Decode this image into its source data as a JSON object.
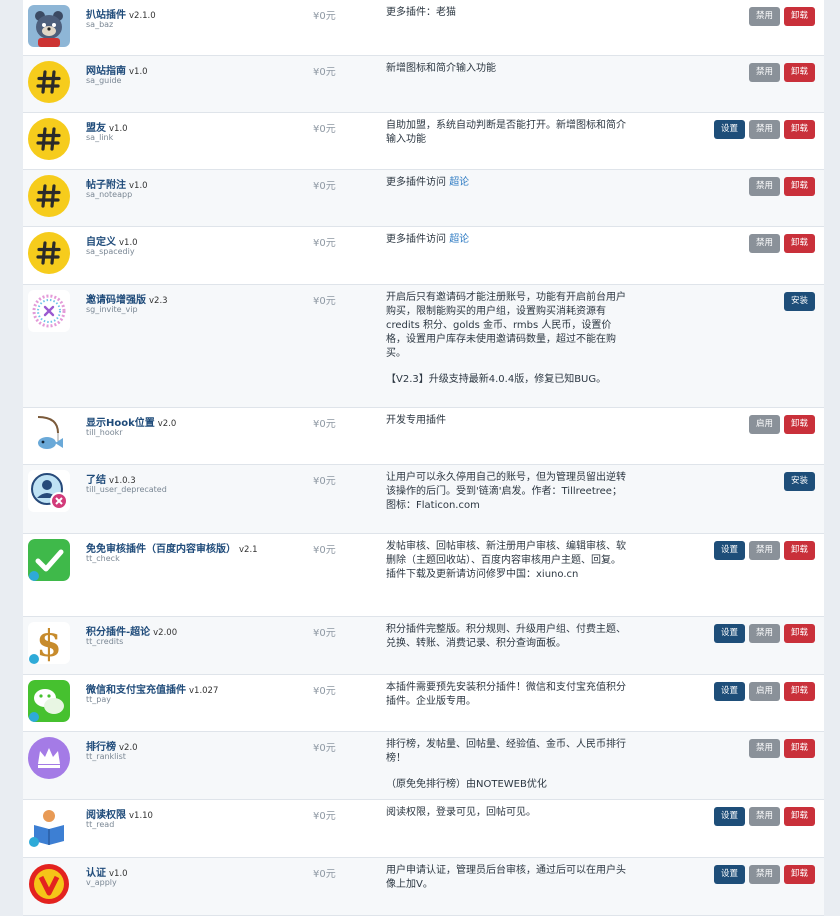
{
  "labels": {
    "settings": "设置",
    "disable": "禁用",
    "enable": "启用",
    "uninstall": "卸载",
    "install": "安装"
  },
  "plugins": [
    {
      "title": "扒站插件",
      "version": "v2.1.0",
      "id": "sa_baz",
      "price": "¥0元",
      "desc": [
        "更多插件：老猫"
      ],
      "link": "",
      "buttons": [
        "disable",
        "uninstall"
      ],
      "icon": "bear-icon"
    },
    {
      "title": "网站指南",
      "version": "v1.0",
      "id": "sa_guide",
      "price": "¥0元",
      "desc": [
        "新增图标和简介输入功能"
      ],
      "link": "",
      "buttons": [
        "disable",
        "uninstall"
      ],
      "icon": "hash-icon"
    },
    {
      "title": "盟友",
      "version": "v1.0",
      "id": "sa_link",
      "price": "¥0元",
      "desc": [
        "自助加盟，系统自动判断是否能打开。新增图标和简介输入功能"
      ],
      "link": "",
      "buttons": [
        "settings",
        "disable",
        "uninstall"
      ],
      "icon": "hash-icon"
    },
    {
      "title": "帖子附注",
      "version": "v1.0",
      "id": "sa_noteapp",
      "price": "¥0元",
      "desc": [
        "更多插件访问 "
      ],
      "link": "超论",
      "buttons": [
        "disable",
        "uninstall"
      ],
      "icon": "hash-icon"
    },
    {
      "title": "自定义",
      "version": "v1.0",
      "id": "sa_spacediy",
      "price": "¥0元",
      "desc": [
        "更多插件访问 "
      ],
      "link": "超论",
      "buttons": [
        "disable",
        "uninstall"
      ],
      "icon": "hash-icon"
    },
    {
      "title": "邀请码增强版",
      "version": "v2.3",
      "id": "sg_invite_vip",
      "price": "¥0元",
      "desc": [
        "开启后只有邀请码才能注册账号，功能有开启前台用户购买，限制能购买的用户组，设置购买消耗资源有 credits 积分、golds 金币、rmbs 人民币，设置价格，设置用户库存未使用邀请码数量，超过不能在购买。",
        "【V2.3】升级支持最新4.0.4版，修复已知BUG。"
      ],
      "link": "",
      "buttons": [
        "install"
      ],
      "icon": "invite-icon"
    },
    {
      "title": "显示Hook位置",
      "version": "v2.0",
      "id": "till_hookr",
      "price": "¥0元",
      "desc": [
        "开发专用插件"
      ],
      "link": "",
      "buttons": [
        "enable",
        "uninstall"
      ],
      "icon": "fishing-icon"
    },
    {
      "title": "了结",
      "version": "v1.0.3",
      "id": "till_user_deprecated",
      "price": "¥0元",
      "desc": [
        "让用户可以永久停用自己的账号，但为管理员留出逆转该操作的后门。受到'链滴'启发。作者：Tillreetree；图标：Flaticon.com"
      ],
      "link": "",
      "buttons": [
        "install"
      ],
      "icon": "user-remove-icon"
    },
    {
      "title": "免免审核插件（百度内容审核版）",
      "version": "v2.1",
      "id": "tt_check",
      "price": "¥0元",
      "desc": [
        "发帖审核、回帖审核、新注册用户审核、编辑审核、软删除（主题回收站）、百度内容审核用户主题、回复。插件下载及更新请访问修罗中国：xiuno.cn"
      ],
      "link": "",
      "buttons": [
        "settings",
        "disable",
        "uninstall"
      ],
      "icon": "check-icon"
    },
    {
      "title": "积分插件-超论",
      "version": "v2.00",
      "id": "tt_credits",
      "price": "¥0元",
      "desc": [
        "积分插件完整版。积分规则、升级用户组、付费主题、兑换、转账、消费记录、积分查询面板。"
      ],
      "link": "",
      "buttons": [
        "settings",
        "disable",
        "uninstall"
      ],
      "icon": "dollar-icon"
    },
    {
      "title": "微信和支付宝充值插件",
      "version": "v1.027",
      "id": "tt_pay",
      "price": "¥0元",
      "desc": [
        "本插件需要预先安装积分插件！微信和支付宝充值积分插件。企业版专用。"
      ],
      "link": "",
      "buttons": [
        "settings",
        "enable",
        "uninstall"
      ],
      "icon": "wechat-icon"
    },
    {
      "title": "排行榜",
      "version": "v2.0",
      "id": "tt_ranklist",
      "price": "¥0元",
      "desc": [
        "排行榜，发帖量、回帖量、经验值、金币、人民币排行榜！",
        "（原免免排行榜）由NOTEWEB优化"
      ],
      "link": "",
      "buttons": [
        "disable",
        "uninstall"
      ],
      "icon": "crown-icon"
    },
    {
      "title": "阅读权限",
      "version": "v1.10",
      "id": "tt_read",
      "price": "¥0元",
      "desc": [
        "阅读权限，登录可见，回帖可见。"
      ],
      "link": "",
      "buttons": [
        "settings",
        "disable",
        "uninstall"
      ],
      "icon": "reader-icon"
    },
    {
      "title": "认证",
      "version": "v1.0",
      "id": "v_apply",
      "price": "¥0元",
      "desc": [
        "用户申请认证，管理员后台审核，通过后可以在用户头像上加V。"
      ],
      "link": "",
      "buttons": [
        "settings",
        "disable",
        "uninstall"
      ],
      "icon": "verified-v-icon"
    }
  ]
}
